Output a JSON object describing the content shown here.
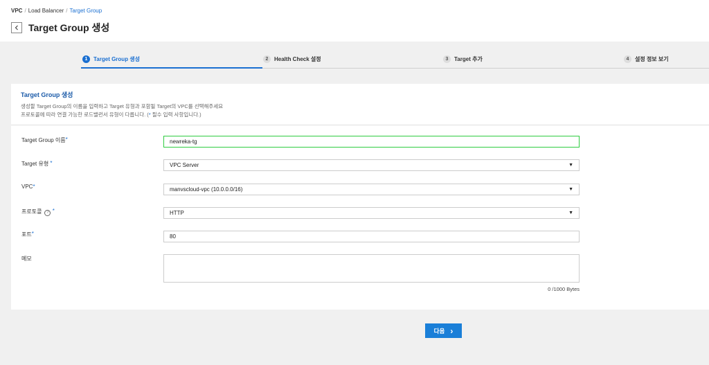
{
  "breadcrumb": {
    "items": [
      "VPC",
      "Load Balancer",
      "Target Group"
    ],
    "sep": "/"
  },
  "page_title": "Target Group 생성",
  "steps": [
    {
      "num": "1",
      "label": "Target Group 생성"
    },
    {
      "num": "2",
      "label": "Health Check 설정"
    },
    {
      "num": "3",
      "label": "Target 추가"
    },
    {
      "num": "4",
      "label": "설정 정보 보기"
    }
  ],
  "panel": {
    "title": "Target Group 생성",
    "desc_line1": "생성할 Target Group의 이름을 입력하고 Target 유형과 포함될 Target의 VPC를 선택해주세요",
    "desc_line2_a": "프로토콜에 따라 연결 가능한 로드밸런서 유형이 다릅니다. (",
    "desc_line2_star": "*",
    "desc_line2_b": " 필수 입력 사항입니다.)"
  },
  "form": {
    "name_label": "Target Group 이름",
    "name_value": "newreka-tg",
    "type_label": "Target 유형",
    "type_value": "VPC Server",
    "vpc_label": "VPC",
    "vpc_value": "manvscloud-vpc (10.0.0.0/16)",
    "protocol_label": "프로토콜",
    "protocol_value": "HTTP",
    "port_label": "포트",
    "port_value": "80",
    "memo_label": "메모",
    "memo_bytes": "0 /1000 Bytes",
    "required_mark": "*",
    "help_glyph": "?",
    "caret_glyph": "▼"
  },
  "next_button": {
    "label": "다음",
    "arrow": "›"
  }
}
